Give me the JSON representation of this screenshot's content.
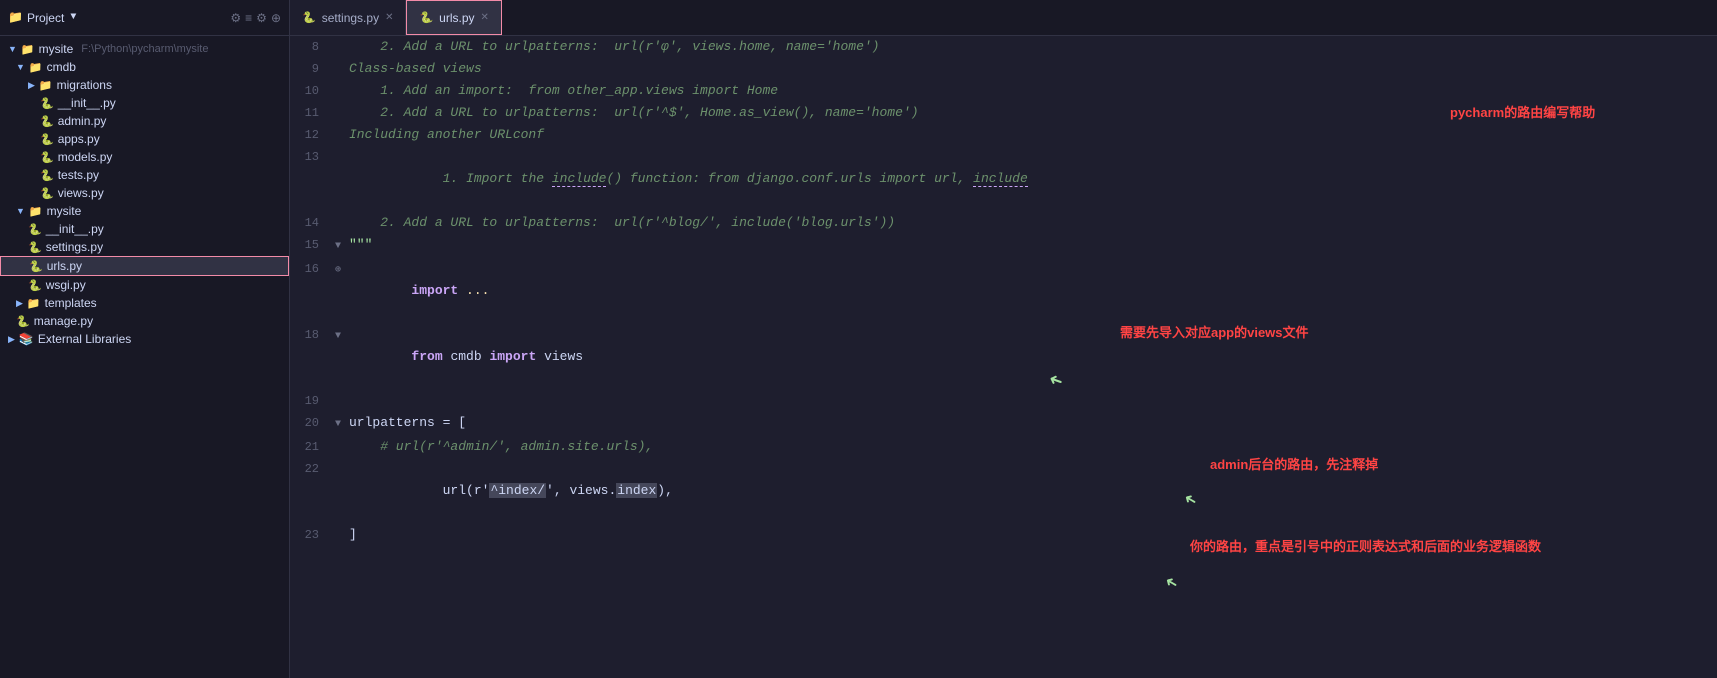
{
  "topbar": {
    "project_label": "Project",
    "project_path": "mysite F:\\Python\\pycharm\\mysite",
    "icons": [
      "⚙",
      "≡",
      "⚙",
      "⏸"
    ],
    "tabs": [
      {
        "id": "settings",
        "label": "settings.py",
        "icon": "🐍",
        "active": false,
        "closeable": true
      },
      {
        "id": "urls",
        "label": "urls.py",
        "icon": "🐍",
        "active": true,
        "closeable": true
      }
    ]
  },
  "sidebar": {
    "items": [
      {
        "id": "mysite-root",
        "label": "mysite",
        "indent": 0,
        "type": "folder",
        "expanded": true,
        "path": "F:\\Python\\pycharm\\mysite"
      },
      {
        "id": "cmdb",
        "label": "cmdb",
        "indent": 1,
        "type": "folder",
        "expanded": true
      },
      {
        "id": "migrations",
        "label": "migrations",
        "indent": 2,
        "type": "folder",
        "expanded": false
      },
      {
        "id": "init1",
        "label": "__init__.py",
        "indent": 3,
        "type": "pyfile"
      },
      {
        "id": "admin",
        "label": "admin.py",
        "indent": 3,
        "type": "pyfile"
      },
      {
        "id": "apps",
        "label": "apps.py",
        "indent": 3,
        "type": "pyfile"
      },
      {
        "id": "models",
        "label": "models.py",
        "indent": 3,
        "type": "pyfile"
      },
      {
        "id": "tests",
        "label": "tests.py",
        "indent": 3,
        "type": "pyfile"
      },
      {
        "id": "views",
        "label": "views.py",
        "indent": 3,
        "type": "pyfile"
      },
      {
        "id": "mysite",
        "label": "mysite",
        "indent": 1,
        "type": "folder",
        "expanded": true
      },
      {
        "id": "init2",
        "label": "__init__.py",
        "indent": 2,
        "type": "pyfile"
      },
      {
        "id": "settings",
        "label": "settings.py",
        "indent": 2,
        "type": "pyfile"
      },
      {
        "id": "urls",
        "label": "urls.py",
        "indent": 2,
        "type": "pyfile",
        "selected": true,
        "highlighted": true
      },
      {
        "id": "wsgi",
        "label": "wsgi.py",
        "indent": 2,
        "type": "pyfile"
      },
      {
        "id": "templates",
        "label": "templates",
        "indent": 1,
        "type": "folder"
      },
      {
        "id": "manage",
        "label": "manage.py",
        "indent": 1,
        "type": "pyfile"
      },
      {
        "id": "extlibs",
        "label": "External Libraries",
        "indent": 0,
        "type": "extlib"
      }
    ]
  },
  "code": {
    "lines": [
      {
        "num": 8,
        "fold": "",
        "content": "    2. Add a URL to urlpatterns:  url(r'φ', views.home, name='home')"
      },
      {
        "num": 9,
        "fold": "",
        "content": "Class-based views"
      },
      {
        "num": 10,
        "fold": "",
        "content": "    1. Add an import:  from other_app.views import Home"
      },
      {
        "num": 11,
        "fold": "",
        "content": "    2. Add a URL to urlpatterns:  url(r'^$', Home.as_view(), name='home')"
      },
      {
        "num": 12,
        "fold": "",
        "content": "Including another URLconf"
      },
      {
        "num": 13,
        "fold": "",
        "content": "    1. Import the include() function: from django.conf.urls import url, include"
      },
      {
        "num": 14,
        "fold": "",
        "content": "    2. Add a URL to urlpatterns:  url(r'^blog/', include('blog.urls'))"
      },
      {
        "num": 15,
        "fold": "fold",
        "content": "\"\"\""
      },
      {
        "num": 16,
        "fold": "fold",
        "content": "import ..."
      },
      {
        "num": 18,
        "fold": "fold",
        "content": "from cmdb import views"
      },
      {
        "num": 19,
        "fold": "",
        "content": ""
      },
      {
        "num": 20,
        "fold": "fold",
        "content": "urlpatterns = ["
      },
      {
        "num": 21,
        "fold": "",
        "content": "    # url(r'^admin/', admin.site.urls),"
      },
      {
        "num": 22,
        "fold": "",
        "content": "    url(r'^index/', views.index),"
      },
      {
        "num": 23,
        "fold": "",
        "content": "]"
      }
    ]
  },
  "annotations": {
    "title_annotation": "pycharm的路由编写帮助",
    "import_annotation": "需要先导入对应app的views文件",
    "admin_annotation": "admin后台的路由，先注释掉",
    "url_annotation": "你的路由，重点是引号中的正则表达式和后面的业务逻辑函数"
  },
  "colors": {
    "bg": "#1e1e2e",
    "sidebar_bg": "#181825",
    "active_tab_bg": "#313244",
    "selected_item": "#45475a",
    "comment": "#6c916c",
    "keyword": "#cba6f7",
    "string": "#a6e3a1",
    "name": "#89dceb",
    "plain": "#cdd6f4",
    "accent_red": "#f38ba8",
    "accent_green": "#a6e3a1",
    "accent_yellow": "#f9e2af",
    "accent_orange": "#fab387",
    "annotation_red": "#ff4444"
  }
}
